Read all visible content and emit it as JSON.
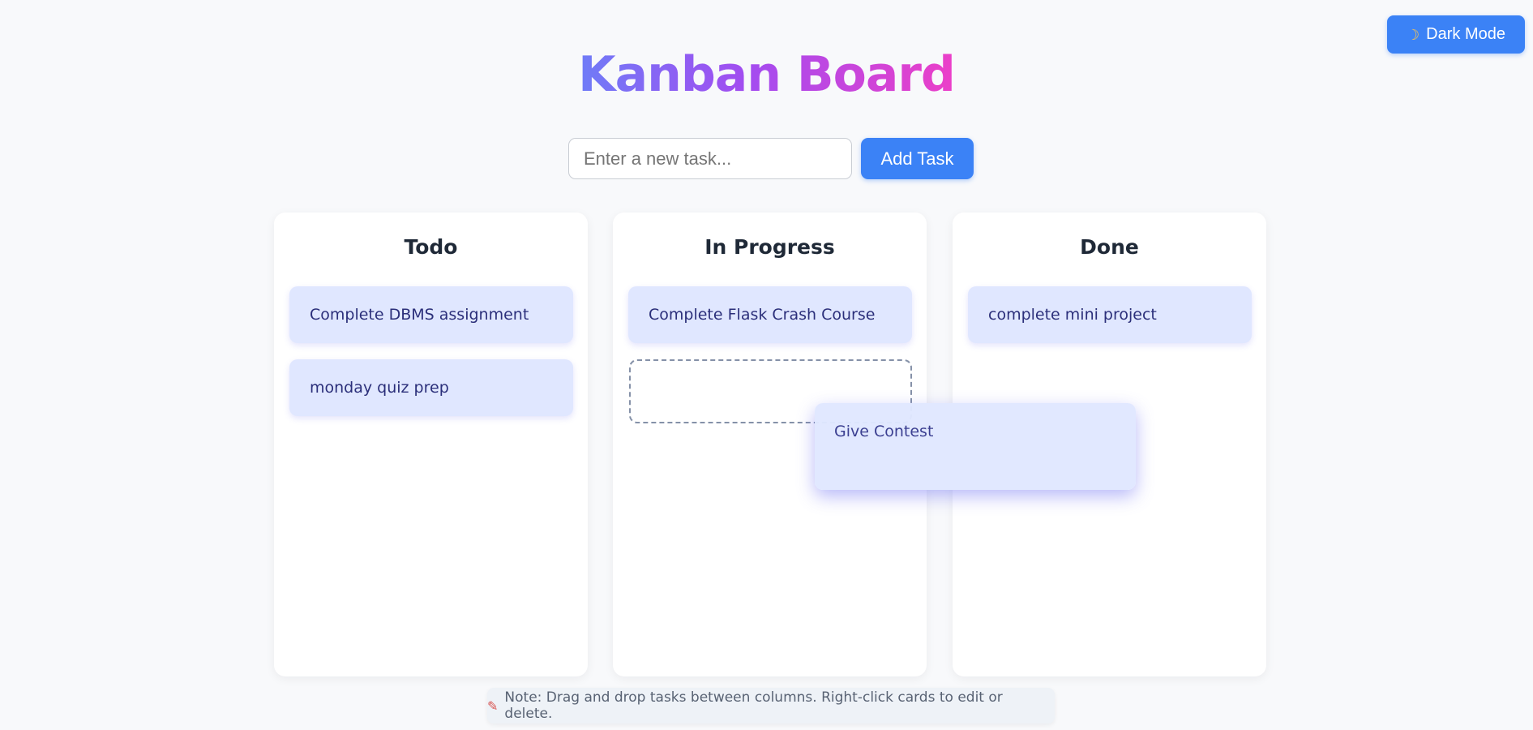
{
  "header": {
    "dark_mode_icon": "moon-icon",
    "dark_mode_label": "Dark Mode",
    "title": "Kanban Board"
  },
  "task_entry": {
    "placeholder": "Enter a new task...",
    "value": "",
    "add_label": "Add Task"
  },
  "columns": [
    {
      "title": "Todo",
      "cards": [
        "Complete DBMS assignment",
        "monday quiz prep"
      ]
    },
    {
      "title": "In Progress",
      "cards": [
        "Complete Flask Crash Course"
      ]
    },
    {
      "title": "Done",
      "cards": [
        "complete mini project"
      ]
    }
  ],
  "dragging": {
    "card": "Give Contest",
    "target_column": "In Progress"
  },
  "footer": {
    "note_icon": "memo-icon",
    "note": "Note: Drag and drop tasks between columns. Right-click cards to edit or delete."
  },
  "colors": {
    "accent": "#3b82f6",
    "card_bg": "#e0e7ff",
    "card_text": "#2b2f7a",
    "title_gradient": [
      "#6f7cf7",
      "#a34cf0",
      "#ec3fc8"
    ],
    "page_bg": "#f8f9fb"
  }
}
